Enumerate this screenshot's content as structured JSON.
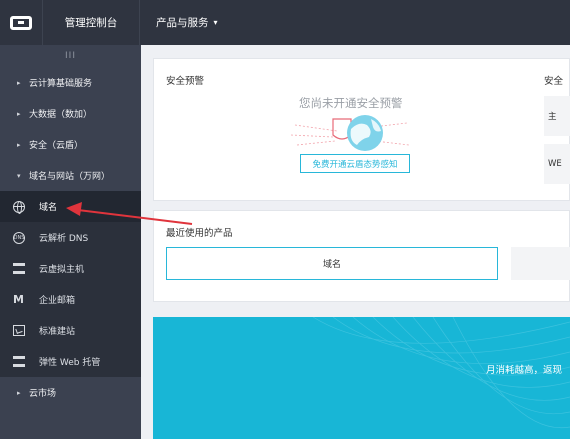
{
  "topbar": {
    "logo_name": "aliyun-logo",
    "console_title": "管理控制台",
    "products_menu": "产品与服务",
    "products_caret": "▾"
  },
  "sidebar": {
    "handle": "III",
    "groups": [
      {
        "label": "云计算基础服务",
        "expanded": false
      },
      {
        "label": "大数据（数加）",
        "expanded": false
      },
      {
        "label": "安全（云盾）",
        "expanded": false
      },
      {
        "label": "域名与网站（万网）",
        "expanded": true
      }
    ],
    "sub_items": [
      {
        "label": "域名",
        "icon": "globe-icon",
        "active": true
      },
      {
        "label": "云解析 DNS",
        "icon": "dns-icon"
      },
      {
        "label": "云虚拟主机",
        "icon": "server-icon"
      },
      {
        "label": "企业邮箱",
        "icon": "mail-icon"
      },
      {
        "label": "标准建站",
        "icon": "site-icon"
      },
      {
        "label": "弹性 Web 托管",
        "icon": "server-icon"
      }
    ],
    "market": "云市场",
    "collapsed_marker": "▸",
    "expanded_marker": "▾"
  },
  "security": {
    "title": "安全预警",
    "title_2": "安全",
    "empty_text": "您尚未开通安全预警",
    "open_button": "免费开通云盾态势感知",
    "side_box_1": "主",
    "side_box_2": "WE"
  },
  "recent": {
    "title": "最近使用的产品",
    "items": [
      "域名"
    ]
  },
  "banner": {
    "text": "月消耗越高，返现",
    "color": "#18b6d6"
  },
  "colors": {
    "accent": "#28b7d9",
    "arrow": "#e0343c",
    "topbar": "#2f3440",
    "sidebar": "#3b4150"
  }
}
